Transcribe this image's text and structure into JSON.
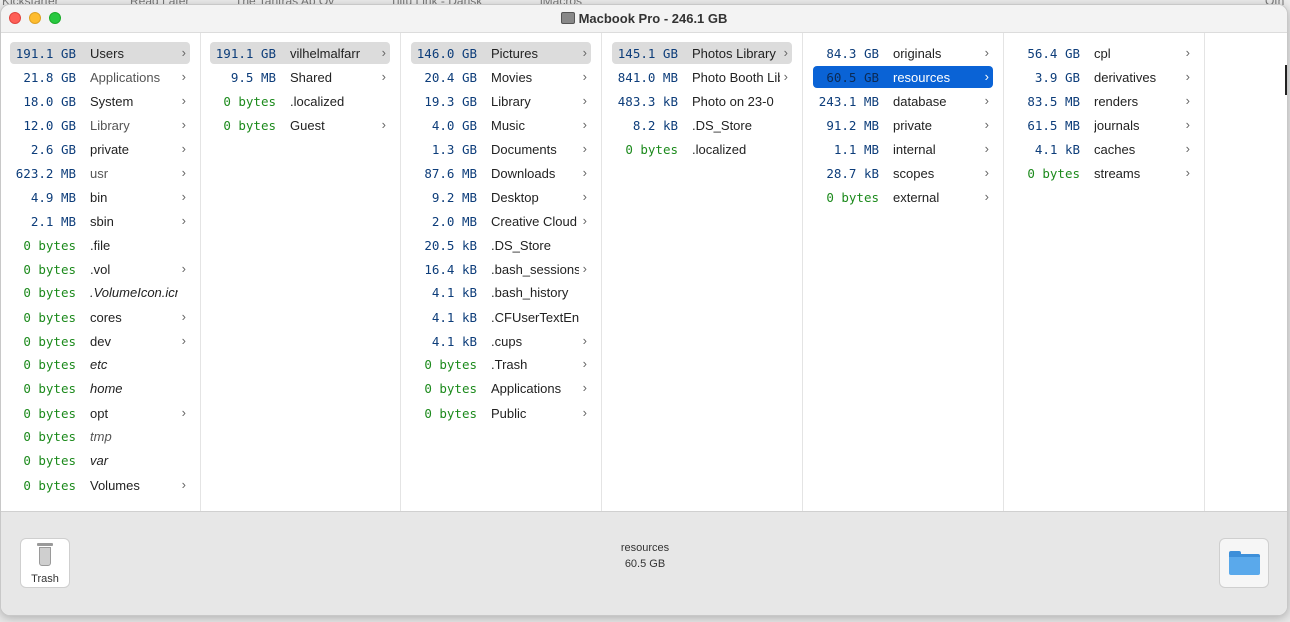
{
  "background_tabs": [
    "Kickstarter",
    "Read Later",
    "The Tantras Ap Oy",
    "Tiltu Link - Dansk",
    "iMacros",
    "Oth"
  ],
  "window": {
    "title": "Macbook Pro - 246.1 GB"
  },
  "columns": [
    {
      "items": [
        {
          "size": "191.1 GB",
          "name": "Users",
          "arrow": true,
          "state": "gray",
          "size_color": "blue"
        },
        {
          "size": "21.8 GB",
          "name": "Applications",
          "arrow": true,
          "size_color": "blue",
          "name_style": "gray"
        },
        {
          "size": "18.0 GB",
          "name": "System",
          "arrow": true,
          "size_color": "blue"
        },
        {
          "size": "12.0 GB",
          "name": "Library",
          "arrow": true,
          "size_color": "blue",
          "name_style": "gray"
        },
        {
          "size": "2.6 GB",
          "name": "private",
          "arrow": true,
          "size_color": "blue"
        },
        {
          "size": "623.2 MB",
          "name": "usr",
          "arrow": true,
          "size_color": "blue",
          "name_style": "gray"
        },
        {
          "size": "4.9 MB",
          "name": "bin",
          "arrow": true,
          "size_color": "blue"
        },
        {
          "size": "2.1 MB",
          "name": "sbin",
          "arrow": true,
          "size_color": "blue"
        },
        {
          "size": "0 bytes",
          "name": ".file",
          "arrow": false,
          "size_color": "green"
        },
        {
          "size": "0 bytes",
          "name": ".vol",
          "arrow": true,
          "size_color": "green"
        },
        {
          "size": "0 bytes",
          "name": ".VolumeIcon.icns",
          "arrow": false,
          "size_color": "green",
          "name_style": "italic"
        },
        {
          "size": "0 bytes",
          "name": "cores",
          "arrow": true,
          "size_color": "green"
        },
        {
          "size": "0 bytes",
          "name": "dev",
          "arrow": true,
          "size_color": "green"
        },
        {
          "size": "0 bytes",
          "name": "etc",
          "arrow": false,
          "size_color": "green",
          "name_style": "italic"
        },
        {
          "size": "0 bytes",
          "name": "home",
          "arrow": false,
          "size_color": "green",
          "name_style": "italic"
        },
        {
          "size": "0 bytes",
          "name": "opt",
          "arrow": true,
          "size_color": "green"
        },
        {
          "size": "0 bytes",
          "name": "tmp",
          "arrow": false,
          "size_color": "green",
          "name_style": "italic-gray"
        },
        {
          "size": "0 bytes",
          "name": "var",
          "arrow": false,
          "size_color": "green",
          "name_style": "italic"
        },
        {
          "size": "0 bytes",
          "name": "Volumes",
          "arrow": true,
          "size_color": "green"
        }
      ]
    },
    {
      "items": [
        {
          "size": "191.1 GB",
          "name": "vilhelmalfarr",
          "arrow": true,
          "state": "gray",
          "size_color": "blue"
        },
        {
          "size": "9.5 MB",
          "name": "Shared",
          "arrow": true,
          "size_color": "blue"
        },
        {
          "size": "0 bytes",
          "name": ".localized",
          "arrow": false,
          "size_color": "green"
        },
        {
          "size": "0 bytes",
          "name": "Guest",
          "arrow": true,
          "size_color": "green"
        }
      ]
    },
    {
      "items": [
        {
          "size": "146.0 GB",
          "name": "Pictures",
          "arrow": true,
          "state": "gray",
          "size_color": "blue"
        },
        {
          "size": "20.4 GB",
          "name": "Movies",
          "arrow": true,
          "size_color": "blue"
        },
        {
          "size": "19.3 GB",
          "name": "Library",
          "arrow": true,
          "size_color": "blue"
        },
        {
          "size": "4.0 GB",
          "name": "Music",
          "arrow": true,
          "size_color": "blue"
        },
        {
          "size": "1.3 GB",
          "name": "Documents",
          "arrow": true,
          "size_color": "blue"
        },
        {
          "size": "87.6 MB",
          "name": "Downloads",
          "arrow": true,
          "size_color": "blue"
        },
        {
          "size": "9.2 MB",
          "name": "Desktop",
          "arrow": true,
          "size_color": "blue"
        },
        {
          "size": "2.0 MB",
          "name": "Creative Cloud Files",
          "arrow": true,
          "size_color": "blue"
        },
        {
          "size": "20.5 kB",
          "name": ".DS_Store",
          "arrow": false,
          "size_color": "blue"
        },
        {
          "size": "16.4 kB",
          "name": ".bash_sessions",
          "arrow": true,
          "size_color": "blue"
        },
        {
          "size": "4.1 kB",
          "name": ".bash_history",
          "arrow": false,
          "size_color": "blue"
        },
        {
          "size": "4.1 kB",
          "name": ".CFUserTextEncoding",
          "arrow": false,
          "size_color": "blue"
        },
        {
          "size": "4.1 kB",
          "name": ".cups",
          "arrow": true,
          "size_color": "blue"
        },
        {
          "size": "0 bytes",
          "name": ".Trash",
          "arrow": true,
          "size_color": "green"
        },
        {
          "size": "0 bytes",
          "name": "Applications",
          "arrow": true,
          "size_color": "green"
        },
        {
          "size": "0 bytes",
          "name": "Public",
          "arrow": true,
          "size_color": "green"
        }
      ]
    },
    {
      "items": [
        {
          "size": "145.1 GB",
          "name": "Photos Library",
          "arrow": true,
          "state": "gray",
          "size_color": "blue"
        },
        {
          "size": "841.0 MB",
          "name": "Photo Booth Library",
          "arrow": true,
          "size_color": "blue"
        },
        {
          "size": "483.3 kB",
          "name": "Photo on 23-0",
          "arrow": false,
          "size_color": "blue"
        },
        {
          "size": "8.2 kB",
          "name": ".DS_Store",
          "arrow": false,
          "size_color": "blue"
        },
        {
          "size": "0 bytes",
          "name": ".localized",
          "arrow": false,
          "size_color": "green"
        }
      ]
    },
    {
      "items": [
        {
          "size": "84.3 GB",
          "name": "originals",
          "arrow": true,
          "size_color": "blue"
        },
        {
          "size": "60.5 GB",
          "name": "resources",
          "arrow": true,
          "state": "blue",
          "size_color": "blue"
        },
        {
          "size": "243.1 MB",
          "name": "database",
          "arrow": true,
          "size_color": "blue"
        },
        {
          "size": "91.2 MB",
          "name": "private",
          "arrow": true,
          "size_color": "blue"
        },
        {
          "size": "1.1 MB",
          "name": "internal",
          "arrow": true,
          "size_color": "blue"
        },
        {
          "size": "28.7 kB",
          "name": "scopes",
          "arrow": true,
          "size_color": "blue"
        },
        {
          "size": "0 bytes",
          "name": "external",
          "arrow": true,
          "size_color": "green"
        }
      ]
    },
    {
      "items": [
        {
          "size": "56.4 GB",
          "name": "cpl",
          "arrow": true,
          "size_color": "blue"
        },
        {
          "size": "3.9 GB",
          "name": "derivatives",
          "arrow": true,
          "size_color": "blue"
        },
        {
          "size": "83.5 MB",
          "name": "renders",
          "arrow": true,
          "size_color": "blue"
        },
        {
          "size": "61.5 MB",
          "name": "journals",
          "arrow": true,
          "size_color": "blue"
        },
        {
          "size": "4.1 kB",
          "name": "caches",
          "arrow": true,
          "size_color": "blue"
        },
        {
          "size": "0 bytes",
          "name": "streams",
          "arrow": true,
          "size_color": "green"
        }
      ]
    }
  ],
  "footer": {
    "trash_label": "Trash",
    "selection_name": "resources",
    "selection_size": "60.5 GB",
    "folder_icon": "folder-icon"
  },
  "colors": {
    "selection_blue": "#0a63d6",
    "size_blue": "#0d3d7a",
    "size_green": "#1c8a1c"
  }
}
